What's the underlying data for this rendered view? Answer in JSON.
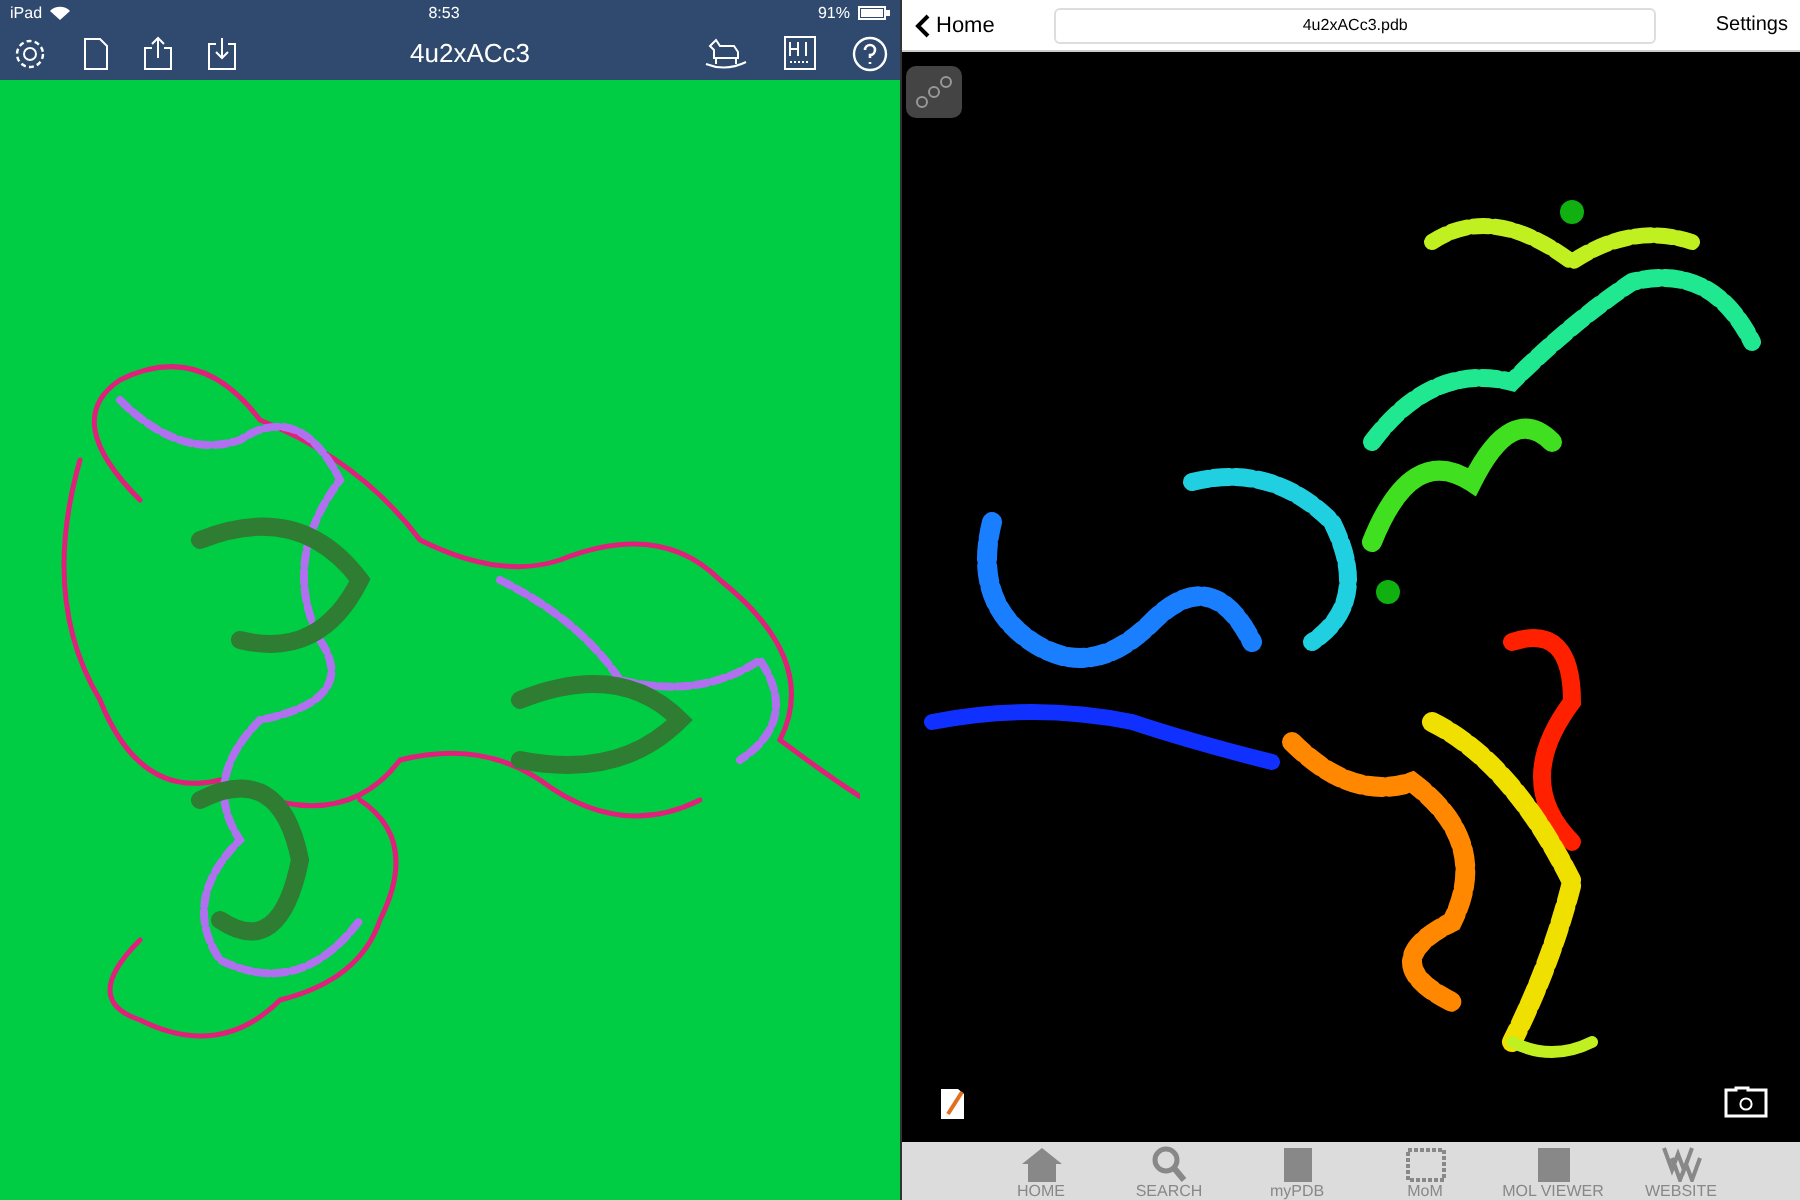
{
  "status_bar": {
    "device": "iPad",
    "time": "8:53",
    "battery": "91%"
  },
  "left_toolbar": {
    "title": "4u2xACc3"
  },
  "right_header": {
    "back": "Home",
    "file_field": "4u2xACc3.pdb",
    "settings": "Settings"
  },
  "tab_bar": [
    {
      "label": "HOME",
      "kind": "home",
      "selected": false
    },
    {
      "label": "SEARCH",
      "kind": "search",
      "selected": false
    },
    {
      "label": "myPDB",
      "kind": "mypdb",
      "selected": false
    },
    {
      "label": "MoM",
      "kind": "mom",
      "selected": false
    },
    {
      "label": "MOL VIEWER",
      "kind": "viewer",
      "selected": false
    },
    {
      "label": "WEBSITE",
      "kind": "website",
      "selected": false
    }
  ]
}
